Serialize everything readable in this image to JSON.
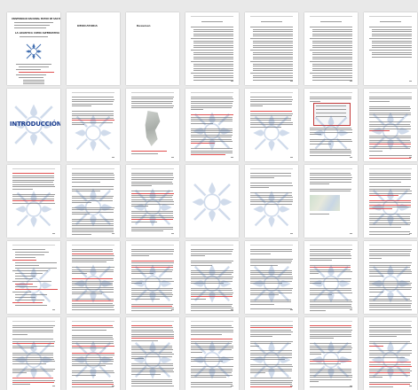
{
  "document": {
    "cover_title": "UNIVERSIDAD NACIONAL MAYOR DE SAN MARCOS",
    "cover_subtitle": "LA LOGISTICA COMO ALTERNATIVA",
    "dedication": "DEDICATORIA",
    "acknowledgement": "Resumen",
    "introduction": "INTRODUCCIÓN"
  },
  "colors": {
    "background": "#e9e9e9",
    "page": "#ffffff",
    "text": "#9a9a9a",
    "highlight": "#e05050",
    "title_blue": "#1a3d8f",
    "watermark": "#2d5fa8"
  },
  "pages": [
    {
      "kind": "cover"
    },
    {
      "kind": "heading",
      "text_ref": "dedication"
    },
    {
      "kind": "heading",
      "text_ref": "acknowledgement"
    },
    {
      "kind": "toc"
    },
    {
      "kind": "toc"
    },
    {
      "kind": "toc"
    },
    {
      "kind": "toc-short"
    },
    {
      "kind": "intro"
    },
    {
      "kind": "text-sparse"
    },
    {
      "kind": "text-map"
    },
    {
      "kind": "text-dense"
    },
    {
      "kind": "text-sparse"
    },
    {
      "kind": "text-diagram"
    },
    {
      "kind": "text-dense"
    },
    {
      "kind": "text-sparse"
    },
    {
      "kind": "text-dense"
    },
    {
      "kind": "text-dense"
    },
    {
      "kind": "watermark-only"
    },
    {
      "kind": "text-sparse"
    },
    {
      "kind": "text-photo"
    },
    {
      "kind": "text-dense"
    },
    {
      "kind": "text-list"
    },
    {
      "kind": "text-dense"
    },
    {
      "kind": "text-dense"
    },
    {
      "kind": "text-dense"
    },
    {
      "kind": "text-dense"
    },
    {
      "kind": "text-dense"
    },
    {
      "kind": "text-dense"
    },
    {
      "kind": "text-dense"
    },
    {
      "kind": "text-dense"
    },
    {
      "kind": "text-dense"
    },
    {
      "kind": "text-dense"
    },
    {
      "kind": "text-dense"
    },
    {
      "kind": "text-dense"
    },
    {
      "kind": "text-dense"
    }
  ]
}
